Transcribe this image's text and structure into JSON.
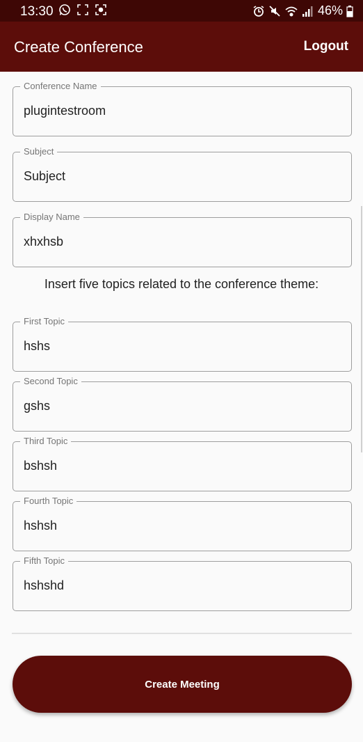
{
  "status_bar": {
    "time": "13:30",
    "battery": "46%",
    "left_icons": [
      "whatsapp-icon",
      "screenshot-frame-icon",
      "screen-record-icon"
    ],
    "right_icons": [
      "alarm-icon",
      "mute-icon",
      "wifi-icon",
      "signal-icon",
      "battery-icon"
    ]
  },
  "app_bar": {
    "title": "Create Conference",
    "logout": "Logout",
    "color": "#5c0d0a"
  },
  "form": {
    "conference_name": {
      "label": "Conference Name",
      "value": "plugintestroom"
    },
    "subject": {
      "label": "Subject",
      "value": "Subject"
    },
    "display_name": {
      "label": "Display Name",
      "value": "xhxhsb"
    },
    "topics_prompt": "Insert five topics related to the conference theme:",
    "first_topic": {
      "label": "First Topic",
      "value": "hshs"
    },
    "second_topic": {
      "label": "Second Topic",
      "value": "gshs"
    },
    "third_topic": {
      "label": "Third Topic",
      "value": "bshsh"
    },
    "fourth_topic": {
      "label": "Fourth Topic",
      "value": "hshsh"
    },
    "fifth_topic": {
      "label": "Fifth Topic",
      "value": "hshshd"
    }
  },
  "actions": {
    "create_meeting": "Create Meeting"
  }
}
